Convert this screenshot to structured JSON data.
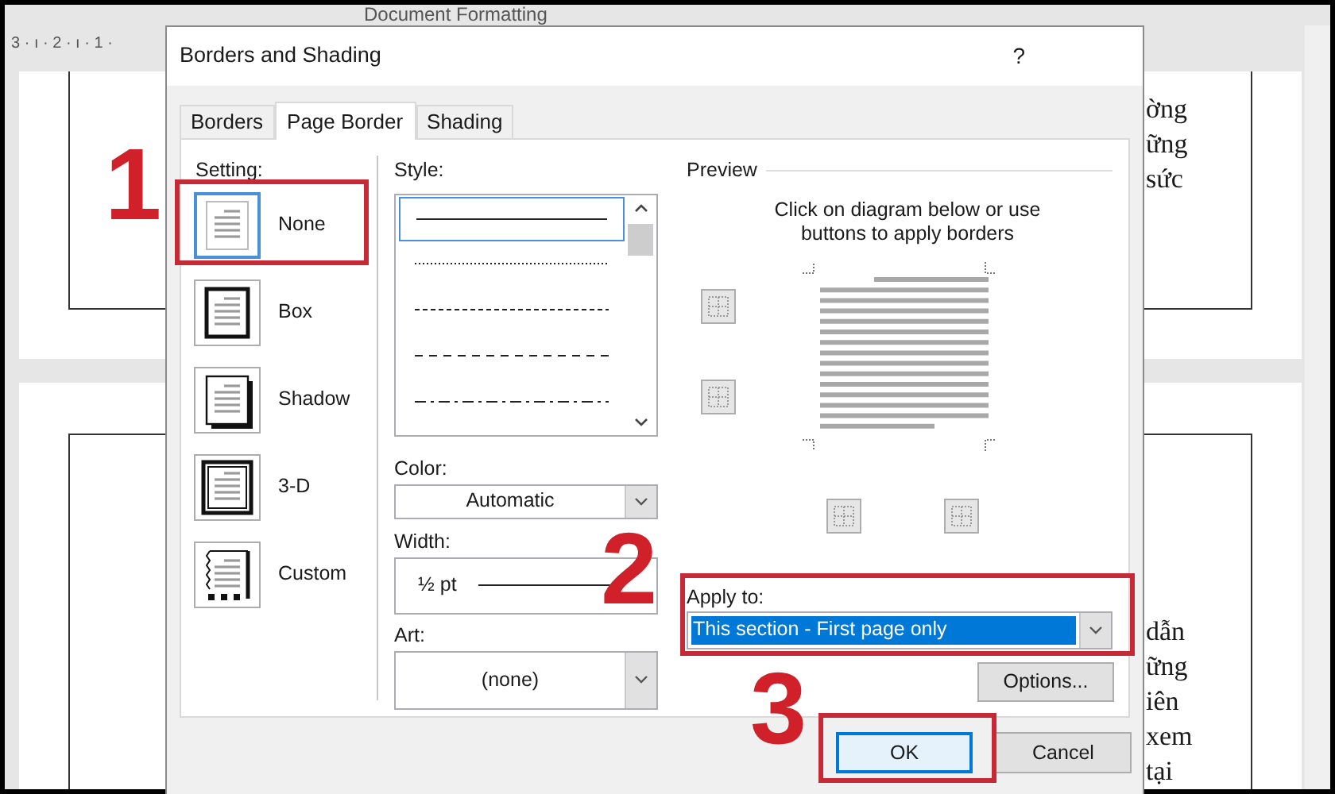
{
  "app_title": "Document Formatting",
  "ruler": "3 · ı · 2 · ı · 1 ·",
  "document_pages": [
    {
      "lines": [
        "ờng",
        "ững",
        "sức"
      ]
    },
    {
      "lines": [
        "dẫn",
        "ững",
        "iên",
        "xem",
        "tại"
      ]
    }
  ],
  "dialog": {
    "title": "Borders and Shading",
    "help": "?",
    "tabs": [
      {
        "label": "Borders",
        "selected": false
      },
      {
        "label": "Page Border",
        "selected": true
      },
      {
        "label": "Shading",
        "selected": false
      }
    ],
    "setting": {
      "label": "Setting:",
      "options": [
        {
          "kind": "none",
          "label": "None",
          "selected": true
        },
        {
          "kind": "box",
          "label": "Box",
          "selected": false
        },
        {
          "kind": "shadow",
          "label": "Shadow",
          "selected": false
        },
        {
          "kind": "threed",
          "label": "3-D",
          "selected": false
        },
        {
          "kind": "custom",
          "label": "Custom",
          "selected": false
        }
      ]
    },
    "style": {
      "label": "Style:",
      "options": [
        {
          "kind": "solid",
          "selected": true
        },
        {
          "kind": "dotted",
          "selected": false
        },
        {
          "kind": "dashed",
          "selected": false
        },
        {
          "kind": "longdashed",
          "selected": false
        },
        {
          "kind": "dashdot",
          "selected": false
        }
      ]
    },
    "color": {
      "label": "Color:",
      "value": "Automatic"
    },
    "width": {
      "label": "Width:",
      "value": "½ pt"
    },
    "art": {
      "label": "Art:",
      "value": "(none)"
    },
    "preview": {
      "label": "Preview",
      "hint": "Click on diagram below or use buttons to apply borders"
    },
    "apply_to": {
      "label": "Apply to:",
      "value": "This section - First page only",
      "highlighted": true
    },
    "options_button": {
      "label": "Options..."
    },
    "buttons": [
      {
        "label": "OK",
        "default": true
      },
      {
        "label": "Cancel",
        "default": false
      }
    ]
  },
  "annotations": [
    {
      "label": "1"
    },
    {
      "label": "2"
    },
    {
      "label": "3"
    }
  ]
}
